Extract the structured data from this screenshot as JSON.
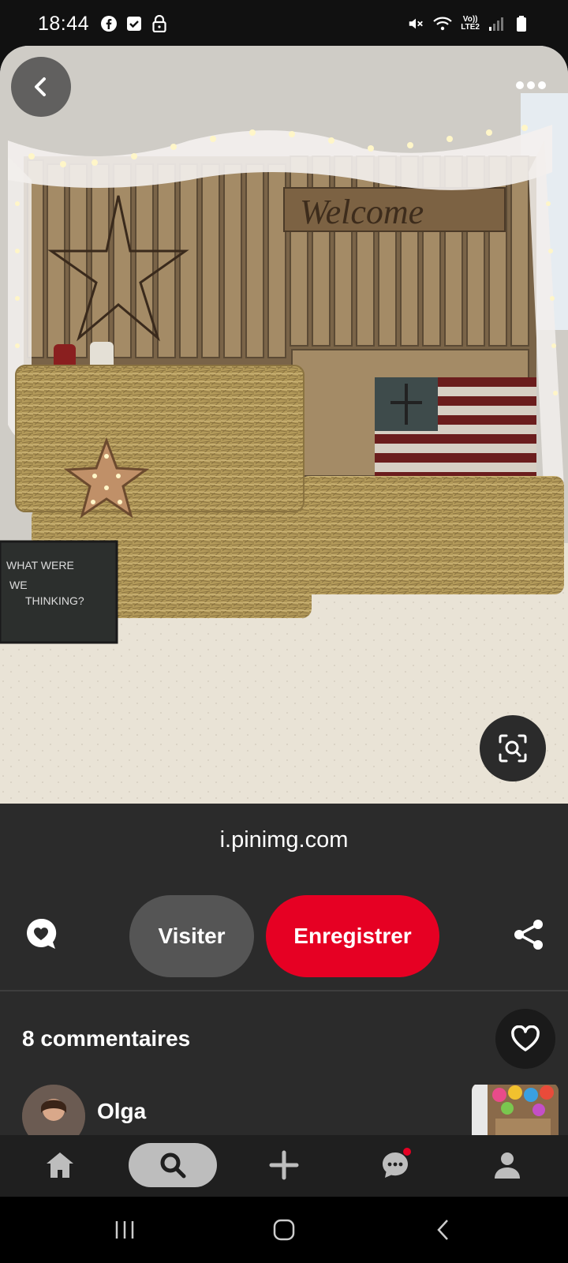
{
  "status_bar": {
    "time": "18:44",
    "left_icons": [
      "facebook-icon",
      "checkbox-icon",
      "lock-icon"
    ],
    "network_line1": "Vo))",
    "network_line2": "LTE2"
  },
  "pin": {
    "image_alt": "Rustic wooden pallet photo backdrop with welcome sign, hay bales and string lights",
    "welcome_sign": "Welcome",
    "chalkboard_line1": "WHAT WERE",
    "chalkboard_line2": "WE",
    "chalkboard_line3": "THINKING?",
    "source": "i.pinimg.com"
  },
  "actions": {
    "visit_label": "Visiter",
    "save_label": "Enregistrer"
  },
  "comments": {
    "title": "8 commentaires",
    "first_user": "Olga"
  },
  "nav": {
    "items": [
      "home-icon",
      "search-icon",
      "plus-icon",
      "messages-icon",
      "profile-icon"
    ],
    "active": "search"
  },
  "colors": {
    "accent": "#e60023",
    "panel": "#2b2b2b",
    "secondary_button": "#555555"
  }
}
